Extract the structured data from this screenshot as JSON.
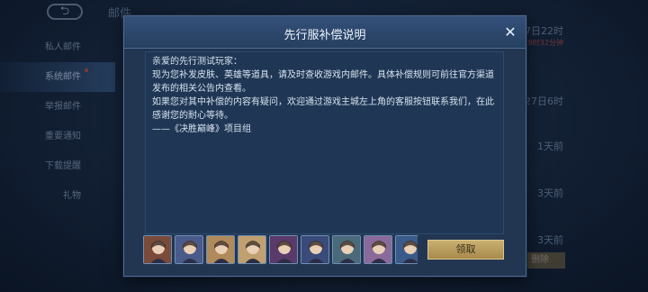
{
  "background": {
    "back_label": "⮌",
    "title": "邮件",
    "sidebar": [
      {
        "label": "私人邮件",
        "active": false
      },
      {
        "label": "系统邮件",
        "active": true
      },
      {
        "label": "举报邮件",
        "active": false
      },
      {
        "label": "重要通知",
        "active": false
      },
      {
        "label": "下载提醒",
        "active": false
      },
      {
        "label": "礼物",
        "active": false
      }
    ],
    "list_rows": [
      {
        "label": "7日22时",
        "sub": "9时32分钟"
      },
      {
        "label": "27日6时",
        "sub": ""
      },
      {
        "label": "1天前",
        "sub": ""
      },
      {
        "label": "3天前",
        "sub": ""
      },
      {
        "label": "3天前",
        "sub": ""
      }
    ],
    "bottom_button": "删除"
  },
  "modal": {
    "title": "先行服补偿说明",
    "close_icon": "close-icon",
    "body": [
      "亲爱的先行测试玩家：",
      "现为您补发皮肤、英雄等道具，请及时查收游戏内邮件。具体补偿规则可前往官方渠道发布的相关公告内查看。",
      "如果您对其中补偿的内容有疑问，欢迎通过游戏主城左上角的客服按钮联系我们，在此感谢您的耐心等待。",
      "——《决胜巅峰》项目组"
    ],
    "rewards": [
      {
        "icon": "hero-portrait-icon",
        "color": "#7a4a3a"
      },
      {
        "icon": "hero-portrait-icon",
        "color": "#4a5a8a"
      },
      {
        "icon": "hero-portrait-icon",
        "color": "#b08a5a"
      },
      {
        "icon": "hero-portrait-icon",
        "color": "#c0a070"
      },
      {
        "icon": "hero-portrait-icon",
        "color": "#5a3a6a"
      },
      {
        "icon": "hero-portrait-icon",
        "color": "#3a4a7a"
      },
      {
        "icon": "hero-portrait-icon",
        "color": "#4a6a7a"
      },
      {
        "icon": "hero-portrait-icon",
        "color": "#8a6a9a"
      },
      {
        "icon": "hero-portrait-icon",
        "color": "#3a5a8a"
      }
    ],
    "claim_label": "领取"
  }
}
